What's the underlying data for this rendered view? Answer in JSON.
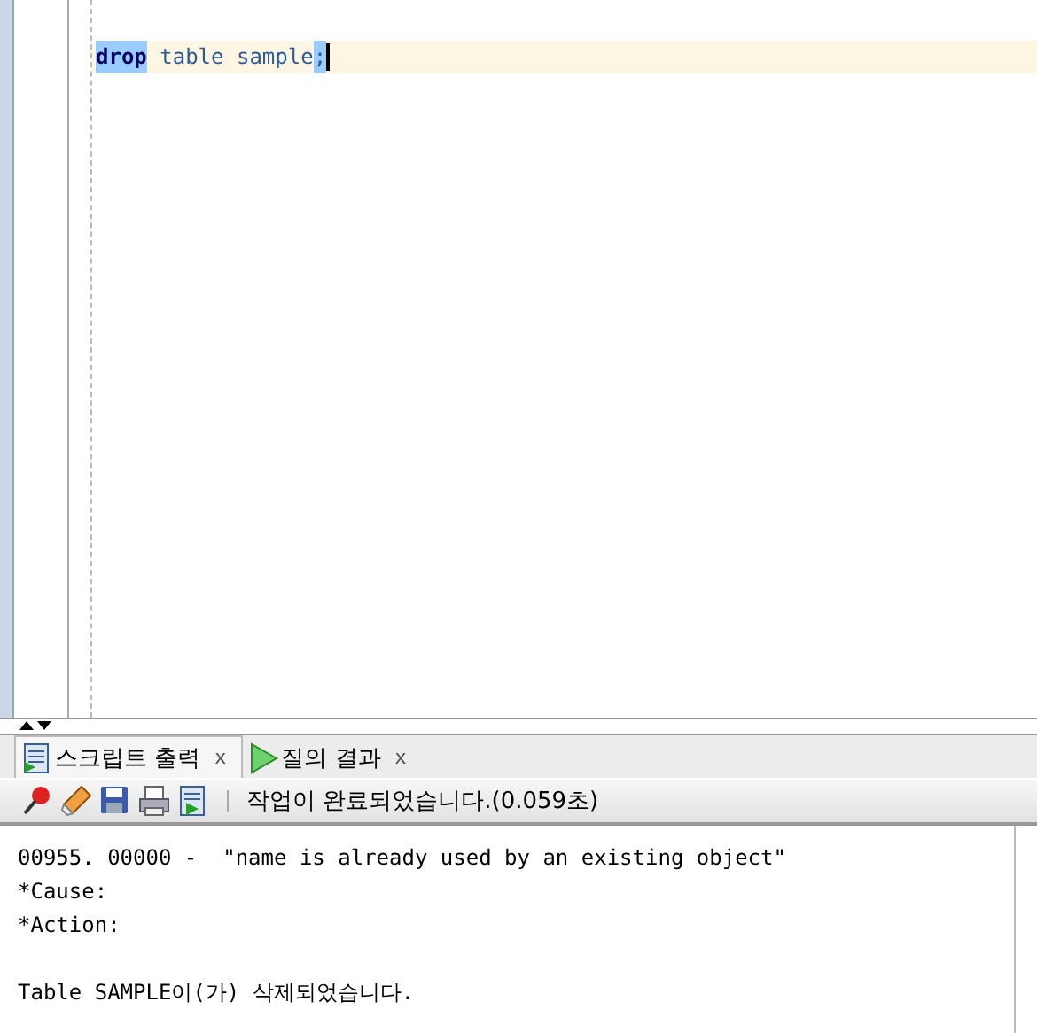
{
  "editor": {
    "lines": [
      {
        "current": true,
        "tokens": [
          {
            "text": "drop",
            "kind": "keyword",
            "selected": true
          },
          {
            "text": "table",
            "kind": "identifier",
            "selected": false
          },
          {
            "text": "sample",
            "kind": "identifier",
            "selected": false
          },
          {
            "text": ";",
            "kind": "punct",
            "selected": true
          }
        ]
      }
    ]
  },
  "tabs": [
    {
      "label": "스크립트 출력",
      "kind": "script",
      "close": "x",
      "selected": true
    },
    {
      "label": "질의 결과",
      "kind": "run",
      "close": "x",
      "selected": false
    }
  ],
  "toolbar": {
    "status": "작업이 완료되었습니다.(0.059초)"
  },
  "output": [
    {
      "text": "00955. 00000 -  \"name is already used by an existing object\"",
      "kind": "error"
    },
    {
      "text": "*Cause:",
      "kind": "error"
    },
    {
      "text": "*Action:",
      "kind": "error"
    },
    {
      "text": "Table SAMPLE이(가) 삭제되었습니다.",
      "kind": "message"
    }
  ]
}
